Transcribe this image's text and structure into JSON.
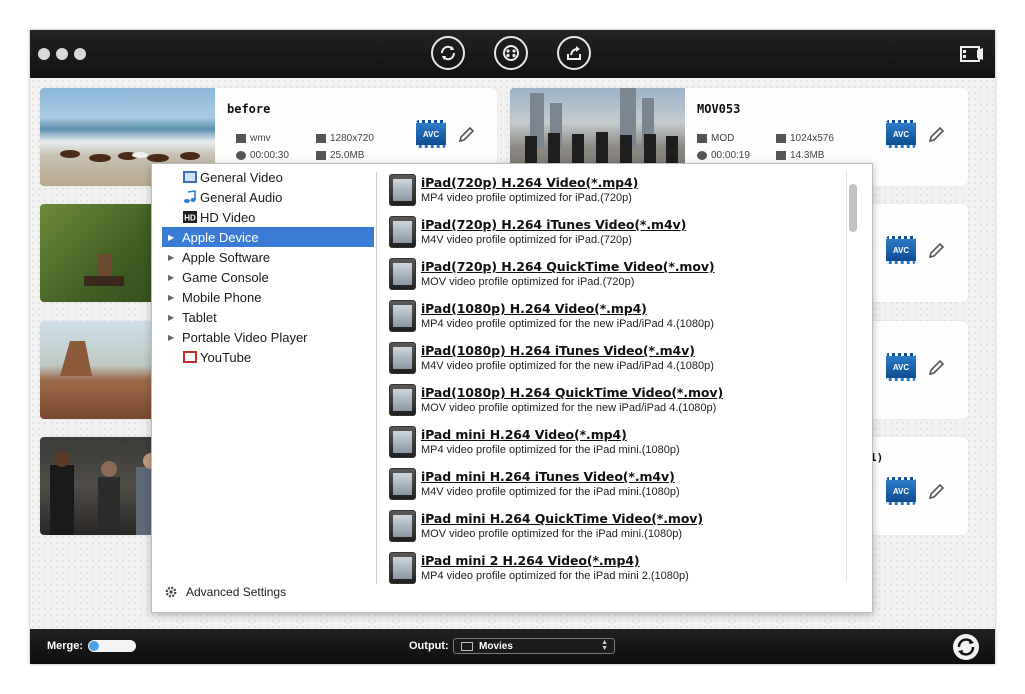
{
  "window": {
    "toolbar_icons": [
      "convert-icon",
      "media-icon",
      "share-icon",
      "media-browser-icon"
    ]
  },
  "files": [
    {
      "name": "before",
      "format": "wmv",
      "resolution": "1280x720",
      "duration": "00:00:30",
      "size": "25.0MB",
      "codec_badge": "AVC"
    },
    {
      "name": "MOV053",
      "format": "MOD",
      "resolution": "1024x576",
      "duration": "00:00:19",
      "size": "14.3MB",
      "codec_badge": "AVC"
    }
  ],
  "partial_text": "1)",
  "profile_menu": {
    "categories": [
      {
        "label": "General Video",
        "icon": "film-icon",
        "expandable": false,
        "selected": false
      },
      {
        "label": "General Audio",
        "icon": "music-note-icon",
        "expandable": false,
        "selected": false
      },
      {
        "label": "HD Video",
        "icon": "hd-icon",
        "expandable": false,
        "selected": false
      },
      {
        "label": "Apple Device",
        "icon": "",
        "expandable": true,
        "selected": true
      },
      {
        "label": "Apple Software",
        "icon": "",
        "expandable": true,
        "selected": false
      },
      {
        "label": "Game Console",
        "icon": "",
        "expandable": true,
        "selected": false
      },
      {
        "label": "Mobile Phone",
        "icon": "",
        "expandable": true,
        "selected": false
      },
      {
        "label": "Tablet",
        "icon": "",
        "expandable": true,
        "selected": false
      },
      {
        "label": "Portable Video Player",
        "icon": "",
        "expandable": true,
        "selected": false
      },
      {
        "label": "YouTube",
        "icon": "youtube-icon",
        "expandable": false,
        "selected": false
      }
    ],
    "advanced_label": "Advanced Settings",
    "profiles": [
      {
        "title": "iPad(720p) H.264 Video(*.mp4)",
        "desc": "MP4 video profile optimized for iPad.(720p)"
      },
      {
        "title": "iPad(720p) H.264 iTunes Video(*.m4v)",
        "desc": "M4V video profile optimized for iPad.(720p)"
      },
      {
        "title": "iPad(720p) H.264 QuickTime Video(*.mov)",
        "desc": "MOV video profile optimized for iPad.(720p)"
      },
      {
        "title": "iPad(1080p) H.264 Video(*.mp4)",
        "desc": "MP4 video profile optimized for the new iPad/iPad 4.(1080p)"
      },
      {
        "title": "iPad(1080p) H.264 iTunes Video(*.m4v)",
        "desc": "M4V video profile optimized for the new iPad/iPad 4.(1080p)"
      },
      {
        "title": "iPad(1080p) H.264 QuickTime Video(*.mov)",
        "desc": "MOV video profile optimized for the new iPad/iPad 4.(1080p)"
      },
      {
        "title": "iPad mini H.264 Video(*.mp4)",
        "desc": "MP4 video profile optimized for the iPad mini.(1080p)"
      },
      {
        "title": "iPad mini H.264 iTunes Video(*.m4v)",
        "desc": "M4V video profile optimized for the iPad mini.(1080p)"
      },
      {
        "title": "iPad mini H.264 QuickTime Video(*.mov)",
        "desc": "MOV video profile optimized for the iPad mini.(1080p)"
      },
      {
        "title": "iPad mini 2 H.264 Video(*.mp4)",
        "desc": "MP4 video profile optimized for the iPad mini 2.(1080p)"
      }
    ]
  },
  "bottom": {
    "merge_label": "Merge:",
    "merge_on": false,
    "output_label": "Output:",
    "output_value": "Movies"
  }
}
